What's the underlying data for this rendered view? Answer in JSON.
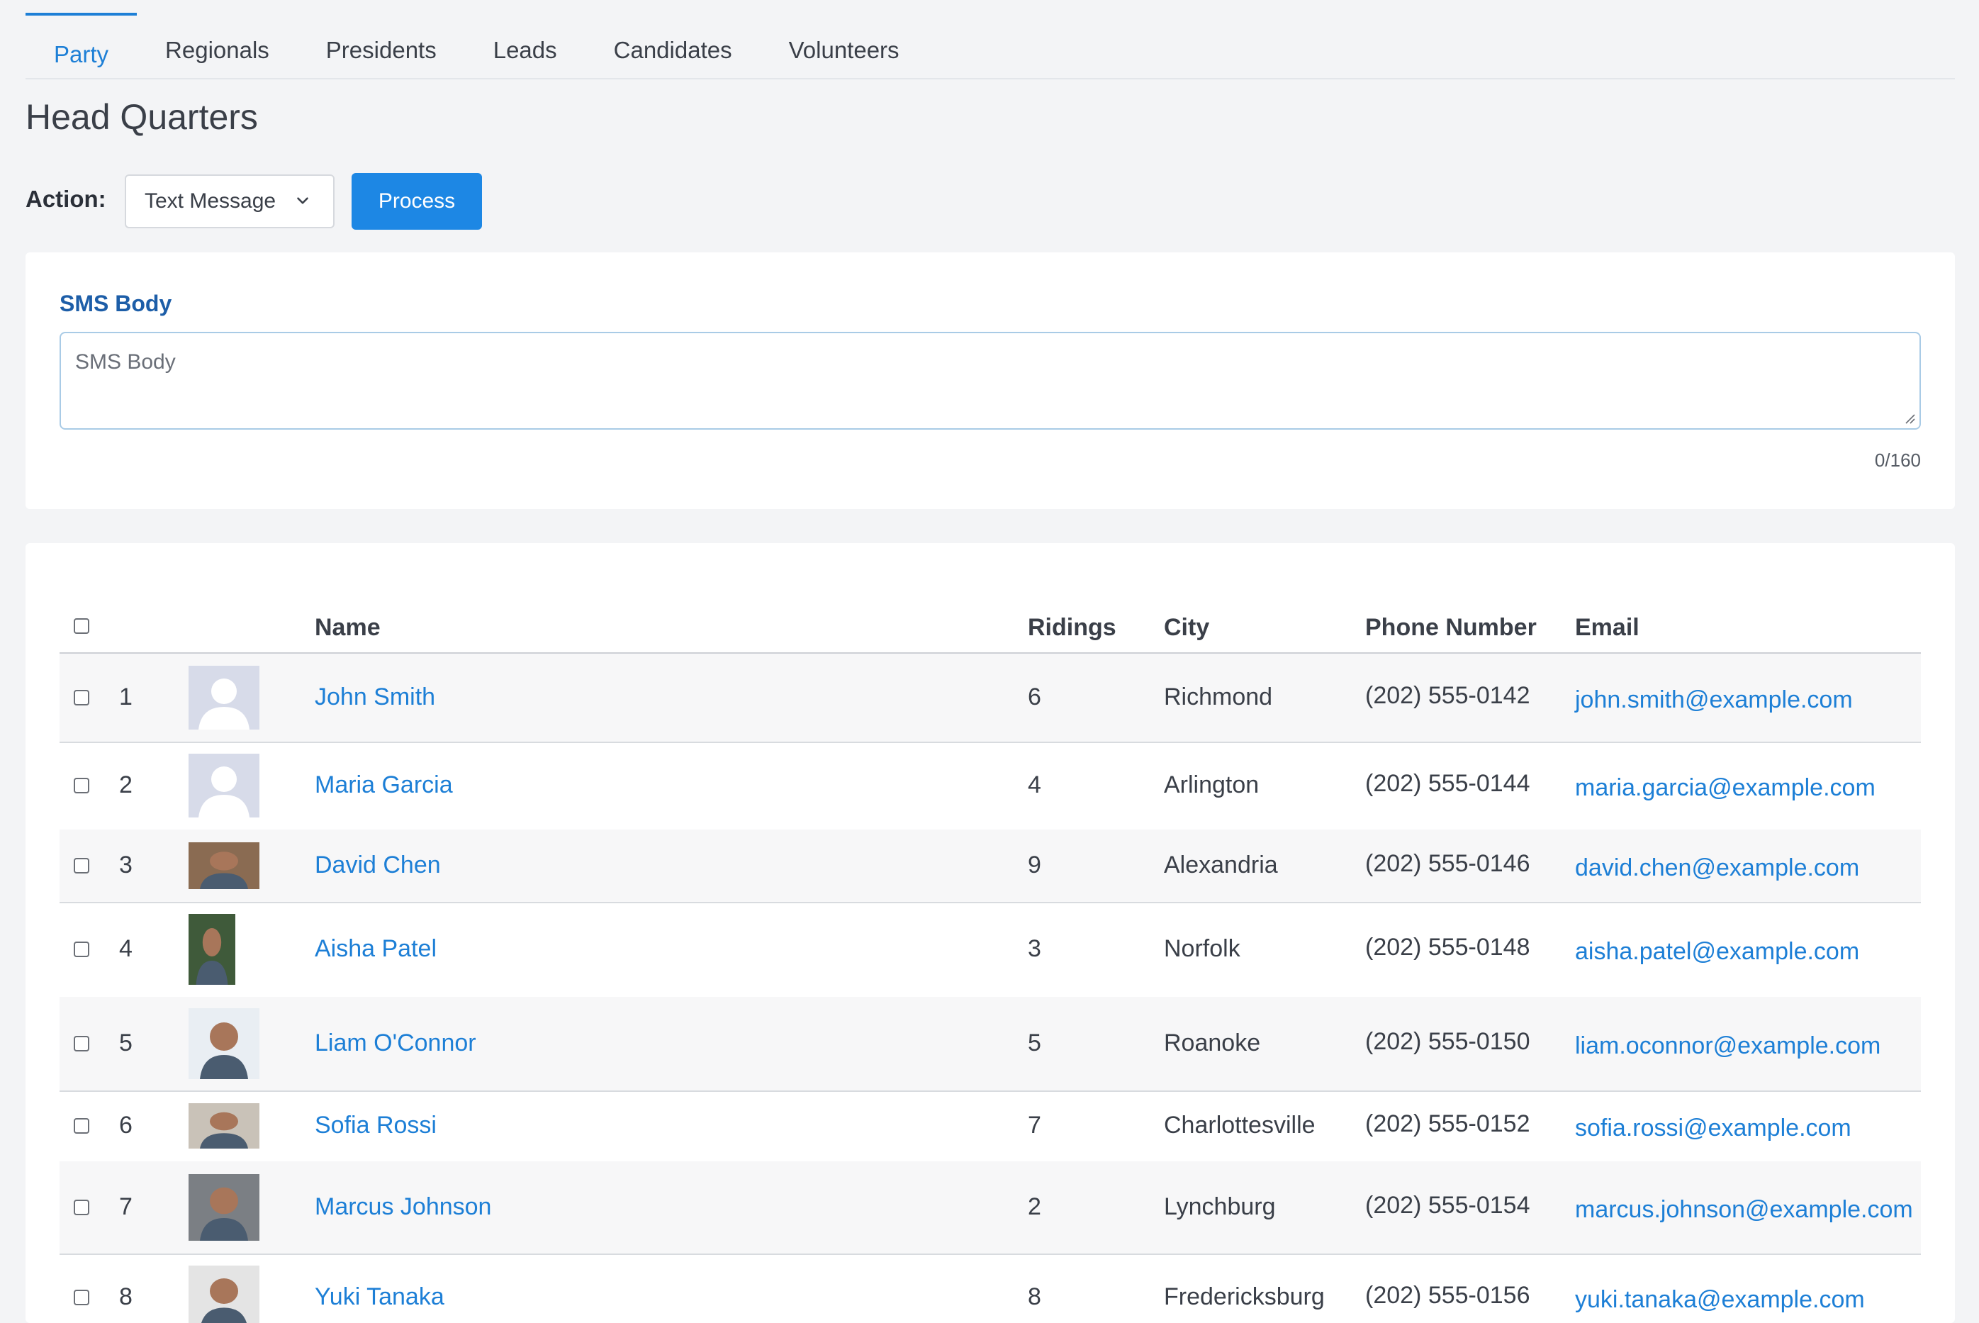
{
  "tabs": [
    {
      "label": "Party",
      "active": true
    },
    {
      "label": "Regionals"
    },
    {
      "label": "Presidents"
    },
    {
      "label": "Leads"
    },
    {
      "label": "Candidates"
    },
    {
      "label": "Volunteers"
    }
  ],
  "page_title": "Head Quarters",
  "action": {
    "label": "Action:",
    "selected": "Text Message",
    "button": "Process"
  },
  "sms": {
    "label": "SMS Body",
    "placeholder": "SMS Body",
    "counter": "0/160"
  },
  "table": {
    "headers": {
      "name": "Name",
      "ridings": "Ridings",
      "city": "City",
      "phone": "Phone Number",
      "email": "Email"
    },
    "rows": [
      {
        "num": "1",
        "name": "John Smith",
        "ridings": "6",
        "city": "Richmond",
        "phone": "(202) 555-0142",
        "email": "john.smith@example.com",
        "avatar": "placeholder"
      },
      {
        "num": "2",
        "name": "Maria Garcia",
        "ridings": "4",
        "city": "Arlington",
        "phone": "(202) 555-0144",
        "email": "maria.garcia@example.com",
        "avatar": "placeholder"
      },
      {
        "num": "3",
        "name": "David Chen",
        "ridings": "9",
        "city": "Alexandria",
        "phone": "(202) 555-0146",
        "email": "david.chen@example.com",
        "avatar": "photo"
      },
      {
        "num": "4",
        "name": "Aisha Patel",
        "ridings": "3",
        "city": "Norfolk",
        "phone": "(202) 555-0148",
        "email": "aisha.patel@example.com",
        "avatar": "photo"
      },
      {
        "num": "5",
        "name": "Liam O'Connor",
        "ridings": "5",
        "city": "Roanoke",
        "phone": "(202) 555-0150",
        "email": "liam.oconnor@example.com",
        "avatar": "photo"
      },
      {
        "num": "6",
        "name": "Sofia Rossi",
        "ridings": "7",
        "city": "Charlottesville",
        "phone": "(202) 555-0152",
        "email": "sofia.rossi@example.com",
        "avatar": "photo"
      },
      {
        "num": "7",
        "name": "Marcus Johnson",
        "ridings": "2",
        "city": "Lynchburg",
        "phone": "(202) 555-0154",
        "email": "marcus.johnson@example.com",
        "avatar": "photo"
      },
      {
        "num": "8",
        "name": "Yuki Tanaka",
        "ridings": "8",
        "city": "Fredericksburg",
        "phone": "(202) 555-0156",
        "email": "yuki.tanaka@example.com",
        "avatar": "photo"
      }
    ]
  },
  "colors": {
    "accent": "#1d7fd6",
    "button": "#1d87e4",
    "label": "#1d5ea8"
  }
}
